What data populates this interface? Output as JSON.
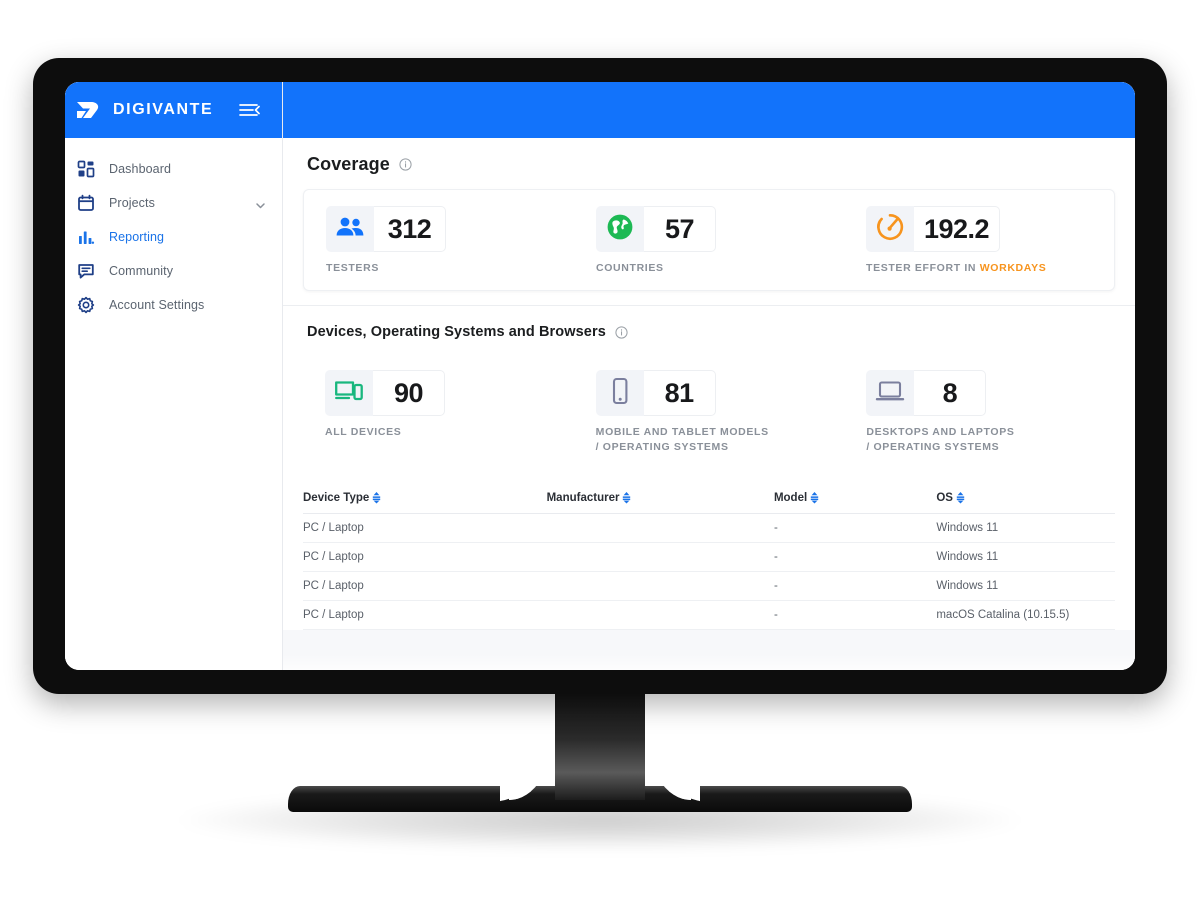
{
  "app": {
    "brand": "DIGIVANTE",
    "logo_icon": "digivante-arrow-logo",
    "collapse_icon": "collapse-sidebar-icon",
    "brand_color": "#1273fb"
  },
  "sidebar": {
    "items": [
      {
        "label": "Dashboard",
        "icon": "grid-dashboard-icon",
        "active": false,
        "has_chevron": false
      },
      {
        "label": "Projects",
        "icon": "calendar-icon",
        "active": false,
        "has_chevron": true
      },
      {
        "label": "Reporting",
        "icon": "bar-chart-icon",
        "active": true,
        "has_chevron": false
      },
      {
        "label": "Community",
        "icon": "chat-bubble-icon",
        "active": false,
        "has_chevron": false
      },
      {
        "label": "Account Settings",
        "icon": "gear-icon",
        "active": false,
        "has_chevron": false
      }
    ]
  },
  "coverage": {
    "title": "Coverage",
    "info_icon": "info-icon",
    "stats": [
      {
        "value": "312",
        "label": "TESTERS",
        "label_highlight": "",
        "icon": "people-icon",
        "icon_color": "#1273fb"
      },
      {
        "value": "57",
        "label": "COUNTRIES",
        "label_highlight": "",
        "icon": "globe-icon",
        "icon_color": "#1db954"
      },
      {
        "value": "192.2",
        "label": "TESTER EFFORT IN ",
        "label_highlight": "WORKDAYS",
        "icon": "gauge-icon",
        "icon_color": "#f7941e"
      }
    ]
  },
  "devices": {
    "title": "Devices, Operating Systems and Browsers",
    "info_icon": "info-icon",
    "stats": [
      {
        "value": "90",
        "label": "ALL DEVICES",
        "icon": "all-devices-icon",
        "icon_color": "#19b77e"
      },
      {
        "value": "81",
        "label": "MOBILE AND TABLET MODELS\n/ OPERATING SYSTEMS",
        "icon": "mobile-phone-icon",
        "icon_color": "#7b7f9e"
      },
      {
        "value": "8",
        "label": "DESKTOPS AND LAPTOPS\n/ OPERATING SYSTEMS",
        "icon": "laptop-icon",
        "icon_color": "#7b7f9e"
      }
    ],
    "table": {
      "columns": [
        "Device Type",
        "Manufacturer",
        "Model",
        "OS"
      ],
      "sort_icon": "sort-icon",
      "rows": [
        {
          "device_type": "PC / Laptop",
          "manufacturer": "",
          "model": "-",
          "os": "Windows 11"
        },
        {
          "device_type": "PC / Laptop",
          "manufacturer": "",
          "model": "-",
          "os": "Windows 11"
        },
        {
          "device_type": "PC / Laptop",
          "manufacturer": "",
          "model": "-",
          "os": "Windows 11"
        },
        {
          "device_type": "PC / Laptop",
          "manufacturer": "",
          "model": "-",
          "os": "macOS Catalina (10.15.5)"
        }
      ]
    }
  }
}
